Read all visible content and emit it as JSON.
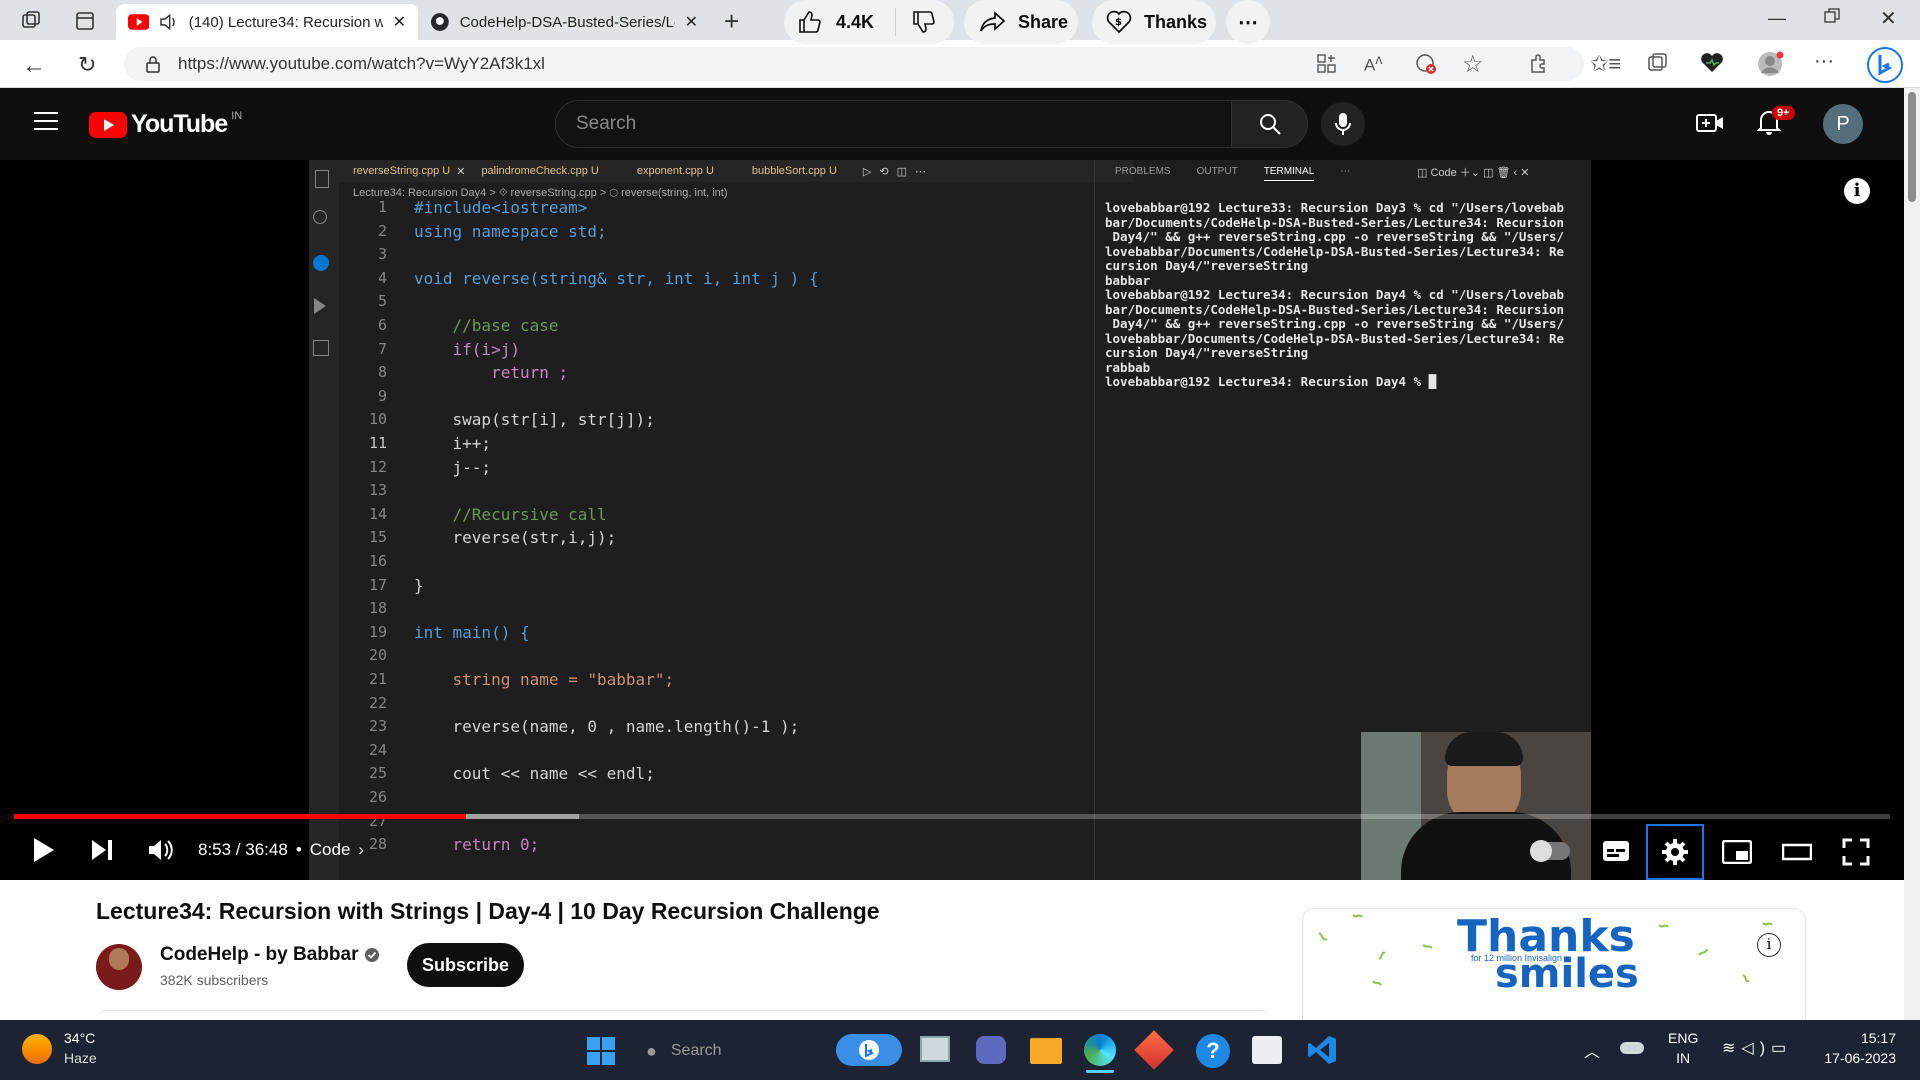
{
  "browser": {
    "tabs": [
      {
        "title": "(140) Lecture34: Recursion w",
        "active": true
      },
      {
        "title": "CodeHelp-DSA-Busted-Series/Le",
        "active": false
      }
    ],
    "url": "https://www.youtube.com/watch?v=WyY2Af3k1xl"
  },
  "youtube": {
    "logo_text": "YouTube",
    "region": "IN",
    "search_placeholder": "Search",
    "notification_count": "9+",
    "avatar_letter": "P"
  },
  "vscode": {
    "tabs": [
      "reverseString.cpp U",
      "palindromeCheck.cpp U",
      "exponent.cpp U",
      "bubbleSort.cpp U"
    ],
    "breadcrumb": "Lecture34: Recursion Day4 > ⟐ reverseString.cpp > ⬡ reverse(string, int, int)",
    "panel_tabs": [
      "PROBLEMS",
      "OUTPUT",
      "TERMINAL"
    ],
    "panel_right": "Code",
    "code_lines": [
      "#include<iostream>",
      "using namespace std;",
      "",
      "void reverse(string& str, int i, int j ) {",
      "",
      "    //base case",
      "    if(i>j)",
      "        return ;",
      "",
      "    swap(str[i], str[j]);",
      "    i++;",
      "    j--;",
      "",
      "    //Recursive call",
      "    reverse(str,i,j);",
      "",
      "}",
      "",
      "int main() {",
      "",
      "    string name = \"babbar\";",
      "",
      "    reverse(name, 0 , name.length()-1 );",
      "",
      "    cout << name << endl;",
      "",
      "",
      "    return 0;"
    ],
    "line_numbers": [
      "1",
      "2",
      "3",
      "4",
      "5",
      "6",
      "7",
      "8",
      "9",
      "10",
      "11",
      "12",
      "13",
      "14",
      "15",
      "16",
      "17",
      "18",
      "19",
      "20",
      "21",
      "22",
      "23",
      "24",
      "25",
      "26",
      "27",
      "28"
    ],
    "terminal_lines": [
      "lovebabbar@192 Lecture33: Recursion Day3 % cd \"/Users/lovebab",
      "bar/Documents/CodeHelp-DSA-Busted-Series/Lecture34: Recursion",
      " Day4/\" && g++ reverseString.cpp -o reverseString && \"/Users/",
      "lovebabbar/Documents/CodeHelp-DSA-Busted-Series/Lecture34: Re",
      "cursion Day4/\"reverseString",
      "babbar",
      "lovebabbar@192 Lecture34: Recursion Day4 % cd \"/Users/lovebab",
      "bar/Documents/CodeHelp-DSA-Busted-Series/Lecture34: Recursion",
      " Day4/\" && g++ reverseString.cpp -o reverseString && \"/Users/",
      "lovebabbar/Documents/CodeHelp-DSA-Busted-Series/Lecture34: Re",
      "cursion Day4/\"reverseString",
      "rabbab",
      "lovebabbar@192 Lecture34: Recursion Day4 % █"
    ]
  },
  "player": {
    "time": "8:53 / 36:48",
    "chapter": "Code",
    "progress_fraction": 0.241
  },
  "video": {
    "title": "Lecture34: Recursion with Strings | Day-4 | 10 Day Recursion Challenge",
    "channel": "CodeHelp - by Babbar",
    "subscribers": "382K subscribers",
    "subscribe_label": "Subscribe",
    "likes": "4.4K",
    "share_label": "Share",
    "thanks_label": "Thanks"
  },
  "ad": {
    "headline": "Thanks",
    "subline": "for 12 million Invisalign",
    "tail": "smiles"
  },
  "taskbar": {
    "weather_temp": "34°C",
    "weather_desc": "Haze",
    "search_placeholder": "Search",
    "lang_top": "ENG",
    "lang_bottom": "IN",
    "time": "15:17",
    "date": "17-06-2023"
  },
  "colors": {
    "youtube_red": "#ff0000",
    "accent_blue": "#0078d4",
    "vscode_bg": "#1e1e1e"
  }
}
